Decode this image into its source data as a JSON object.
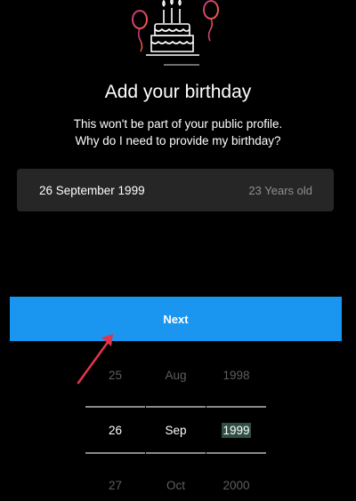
{
  "header": {
    "title": "Add your birthday",
    "subtitle_line1": "This won't be part of your public profile.",
    "subtitle_link": "Why do I need to provide my birthday?"
  },
  "birthday_field": {
    "date": "26 September 1999",
    "age": "23 Years old"
  },
  "next_button": {
    "label": "Next"
  },
  "picker": {
    "day": {
      "prev": "25",
      "selected": "26",
      "next": "27"
    },
    "month": {
      "prev": "Aug",
      "selected": "Sep",
      "next": "Oct"
    },
    "year": {
      "prev": "1998",
      "selected": "1999",
      "next": "2000"
    }
  },
  "colors": {
    "background": "#000000",
    "button": "#1a96f0",
    "field": "#262626",
    "muted_text": "#8e8e8e",
    "arrow": "#e0344a",
    "balloon_gradient_start": "#c13584",
    "balloon_gradient_end": "#f56040"
  },
  "icons": {
    "illustration": "birthday-cake-balloons-icon",
    "annotation": "red-arrow-icon"
  }
}
